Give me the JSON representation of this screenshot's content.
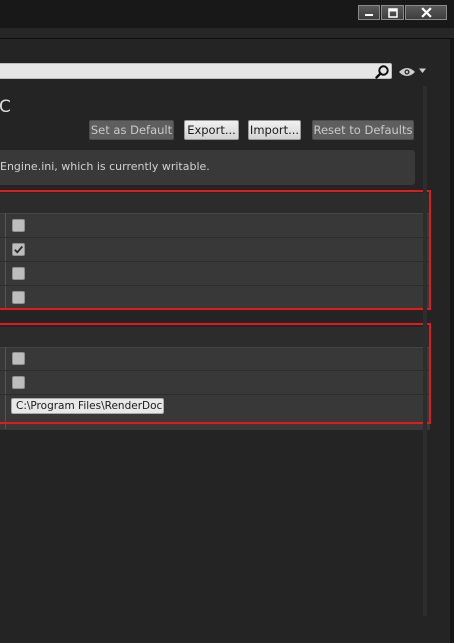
{
  "window": {
    "title": "",
    "minimize_glyph": "▬",
    "maximize_glyph": "▢",
    "close_glyph": "✕"
  },
  "search": {
    "value": "",
    "placeholder": "",
    "icon": "search-icon"
  },
  "view_options": {
    "icon": "eye-icon",
    "chevron_icon": "chevron-down-icon"
  },
  "page": {
    "title": "C"
  },
  "actions": {
    "set_default": "Set as Default",
    "export": "Export...",
    "import": "Import...",
    "reset": "Reset to Defaults"
  },
  "info": {
    "text": "Engine.ini, which is currently writable."
  },
  "sections": [
    {
      "rows": [
        {
          "checked": false
        },
        {
          "checked": true
        },
        {
          "checked": false
        },
        {
          "checked": false
        }
      ]
    },
    {
      "rows": [
        {
          "checked": false
        },
        {
          "checked": false
        }
      ],
      "path_value": "C:\\Program Files\\RenderDoc"
    }
  ],
  "colors": {
    "highlight": "#e01b1b",
    "background": "#242424"
  }
}
